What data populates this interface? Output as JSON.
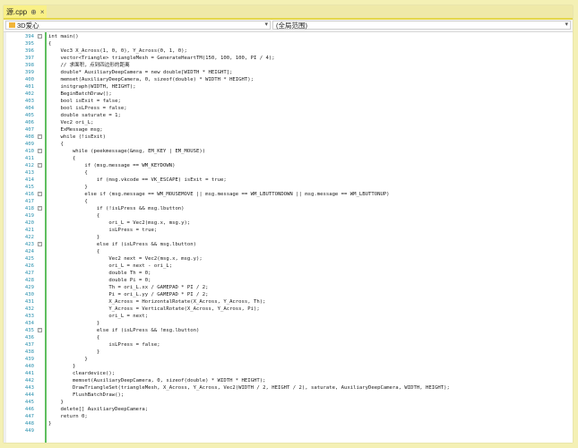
{
  "tab": {
    "title": "源.cpp",
    "pin_glyph": "⊕",
    "close_glyph": "×"
  },
  "nav": {
    "project": "3D爱心",
    "scope": "(全局范围)"
  },
  "colors": {
    "accent": "#e4d64a",
    "line_number": "#2b91af",
    "change_bar": "#5fbf5f"
  },
  "lines": [
    {
      "n": "394",
      "fold": "-",
      "text": "int main()"
    },
    {
      "n": "395",
      "fold": "",
      "text": "{"
    },
    {
      "n": "396",
      "fold": "",
      "text": "    Vec3 X_Across(1, 0, 0), Y_Across(0, 1, 0);"
    },
    {
      "n": "397",
      "fold": "",
      "text": "    vector<Triangle> triangleMesh = GenerateHeartTM(150, 100, 100, PI / 4);"
    },
    {
      "n": "398",
      "fold": "",
      "text": "    // 求面积，点到四边形的距离"
    },
    {
      "n": "399",
      "fold": "",
      "text": "    double* AuxiliaryDeepCamera = new double[WIDTH * HEIGHT];"
    },
    {
      "n": "400",
      "fold": "",
      "text": "    memset(AuxiliaryDeepCamera, 0, sizeof(double) * WIDTH * HEIGHT);"
    },
    {
      "n": "401",
      "fold": "",
      "text": "    initgraph(WIDTH, HEIGHT);"
    },
    {
      "n": "402",
      "fold": "",
      "text": "    BeginBatchDraw();"
    },
    {
      "n": "403",
      "fold": "",
      "text": "    bool isExit = false;"
    },
    {
      "n": "404",
      "fold": "",
      "text": "    bool isLPress = false;"
    },
    {
      "n": "405",
      "fold": "",
      "text": "    double saturate = 1;"
    },
    {
      "n": "406",
      "fold": "",
      "text": "    Vec2 ori_L;"
    },
    {
      "n": "407",
      "fold": "",
      "text": "    ExMessage msg;"
    },
    {
      "n": "408",
      "fold": "-",
      "text": "    while (!isExit)"
    },
    {
      "n": "409",
      "fold": "",
      "text": "    {"
    },
    {
      "n": "410",
      "fold": "-",
      "text": "        while (peekmessage(&msg, EM_KEY | EM_MOUSE))"
    },
    {
      "n": "411",
      "fold": "",
      "text": "        {"
    },
    {
      "n": "412",
      "fold": "-",
      "text": "            if (msg.message == WM_KEYDOWN)"
    },
    {
      "n": "413",
      "fold": "",
      "text": "            {"
    },
    {
      "n": "414",
      "fold": "",
      "text": "                if (msg.vkcode == VK_ESCAPE) isExit = true;"
    },
    {
      "n": "415",
      "fold": "",
      "text": "            }"
    },
    {
      "n": "416",
      "fold": "-",
      "text": "            else if (msg.message == WM_MOUSEMOVE || msg.message == WM_LBUTTONDOWN || msg.message == WM_LBUTTONUP)"
    },
    {
      "n": "417",
      "fold": "",
      "text": "            {"
    },
    {
      "n": "418",
      "fold": "-",
      "text": "                if (!isLPress && msg.lbutton)"
    },
    {
      "n": "419",
      "fold": "",
      "text": "                {"
    },
    {
      "n": "420",
      "fold": "",
      "text": "                    ori_L = Vec2(msg.x, msg.y);"
    },
    {
      "n": "421",
      "fold": "",
      "text": "                    isLPress = true;"
    },
    {
      "n": "422",
      "fold": "",
      "text": "                }"
    },
    {
      "n": "423",
      "fold": "-",
      "text": "                else if (isLPress && msg.lbutton)"
    },
    {
      "n": "424",
      "fold": "",
      "text": "                {"
    },
    {
      "n": "425",
      "fold": "",
      "text": "                    Vec2 next = Vec2(msg.x, msg.y);"
    },
    {
      "n": "426",
      "fold": "",
      "text": "                    ori_L = next - ori_L;"
    },
    {
      "n": "427",
      "fold": "",
      "text": "                    double Th = 0;"
    },
    {
      "n": "428",
      "fold": "",
      "text": "                    double Pi = 0;"
    },
    {
      "n": "429",
      "fold": "",
      "text": "                    Th = ori_L.xx / GAMEPAD * PI / 2;"
    },
    {
      "n": "430",
      "fold": "",
      "text": "                    Pi = ori_L.yy / GAMEPAD * PI / 2;"
    },
    {
      "n": "431",
      "fold": "",
      "text": "                    X_Across = HorizontalRotate(X_Across, Y_Across, Th);"
    },
    {
      "n": "432",
      "fold": "",
      "text": "                    Y_Across = VerticalRotate(X_Across, Y_Across, Pi);"
    },
    {
      "n": "433",
      "fold": "",
      "text": "                    ori_L = next;"
    },
    {
      "n": "434",
      "fold": "",
      "text": "                }"
    },
    {
      "n": "435",
      "fold": "-",
      "text": "                else if (isLPress && !msg.lbutton)"
    },
    {
      "n": "436",
      "fold": "",
      "text": "                {"
    },
    {
      "n": "437",
      "fold": "",
      "text": "                    isLPress = false;"
    },
    {
      "n": "438",
      "fold": "",
      "text": "                }"
    },
    {
      "n": "439",
      "fold": "",
      "text": "            }"
    },
    {
      "n": "440",
      "fold": "",
      "text": "        }"
    },
    {
      "n": "441",
      "fold": "",
      "text": "        cleardevice();"
    },
    {
      "n": "442",
      "fold": "",
      "text": "        memset(AuxiliaryDeepCamera, 0, sizeof(double) * WIDTH * HEIGHT);"
    },
    {
      "n": "443",
      "fold": "",
      "text": "        DrawTriangleSet(triangleMesh, X_Across, Y_Across, Vec2(WIDTH / 2, HEIGHT / 2), saturate, AuxiliaryDeepCamera, WIDTH, HEIGHT);"
    },
    {
      "n": "444",
      "fold": "",
      "text": "        FlushBatchDraw();"
    },
    {
      "n": "445",
      "fold": "",
      "text": "    }"
    },
    {
      "n": "446",
      "fold": "",
      "text": "    delete[] AuxiliaryDeepCamera;"
    },
    {
      "n": "447",
      "fold": "",
      "text": "    return 0;"
    },
    {
      "n": "448",
      "fold": "",
      "text": "}"
    },
    {
      "n": "449",
      "fold": "",
      "text": ""
    }
  ]
}
